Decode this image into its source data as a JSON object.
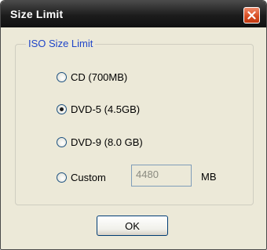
{
  "window": {
    "title": "Size Limit"
  },
  "group": {
    "label": "ISO Size Limit"
  },
  "options": [
    {
      "label": "CD (700MB)",
      "selected": false
    },
    {
      "label": "DVD-5 (4.5GB)",
      "selected": true
    },
    {
      "label": "DVD-9 (8.0 GB)",
      "selected": false
    },
    {
      "label": "Custom",
      "selected": false
    }
  ],
  "custom": {
    "value": "4480",
    "unit": "MB"
  },
  "buttons": {
    "ok": "OK"
  },
  "colors": {
    "titlebar": "#1c1c1c",
    "close_button": "#d64a1f",
    "group_label": "#1f45c9",
    "dialog_bg": "#ece9d8"
  },
  "icons": {
    "close": "close-icon"
  }
}
